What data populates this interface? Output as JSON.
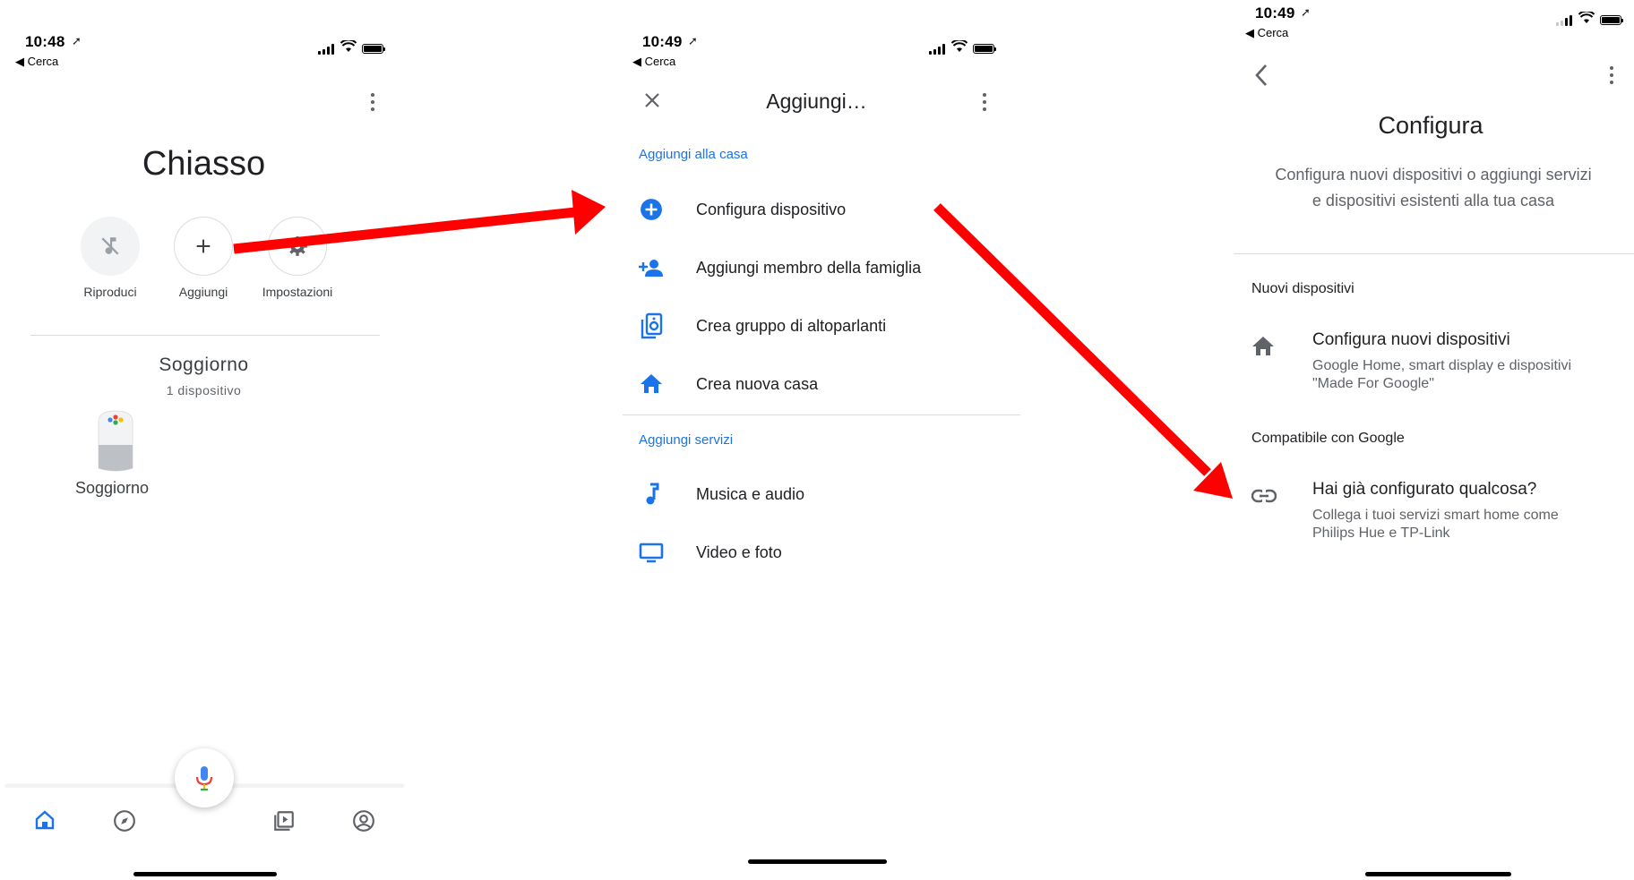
{
  "screen1": {
    "status": {
      "time": "10:48",
      "back": "◀ Cerca"
    },
    "home_name": "Chiasso",
    "actions": [
      {
        "label": "Riproduci",
        "icon": "music-off-icon"
      },
      {
        "label": "Aggiungi",
        "icon": "plus-icon"
      },
      {
        "label": "Impostazioni",
        "icon": "gear-icon"
      }
    ],
    "room": {
      "name": "Soggiorno",
      "count": "1 dispositivo"
    },
    "device": {
      "name": "Soggiorno",
      "icon": "google-home-speaker-icon"
    },
    "nav": [
      "home-icon",
      "explore-icon",
      "media-icon",
      "account-icon"
    ],
    "mic_icon": "mic-icon"
  },
  "screen2": {
    "status": {
      "time": "10:49",
      "back": "◀ Cerca"
    },
    "title": "Aggiungi…",
    "section1": "Aggiungi alla casa",
    "items1": [
      {
        "label": "Configura dispositivo",
        "icon": "add-circle-icon"
      },
      {
        "label": "Aggiungi membro della famiglia",
        "icon": "person-add-icon"
      },
      {
        "label": "Crea gruppo di altoparlanti",
        "icon": "speaker-group-icon"
      },
      {
        "label": "Crea nuova casa",
        "icon": "home-icon"
      }
    ],
    "section2": "Aggiungi servizi",
    "items2": [
      {
        "label": "Musica e audio",
        "icon": "music-note-icon"
      },
      {
        "label": "Video e foto",
        "icon": "tv-icon"
      }
    ]
  },
  "screen3": {
    "status": {
      "time": "10:49",
      "back": "◀ Cerca"
    },
    "title": "Configura",
    "subtitle_line1": "Configura nuovi dispositivi o aggiungi servizi",
    "subtitle_line2": "e dispositivi esistenti alla tua casa",
    "section1": "Nuovi dispositivi",
    "item1": {
      "title": "Configura nuovi dispositivi",
      "desc_line1": "Google Home, smart display e dispositivi",
      "desc_line2": "\"Made For Google\""
    },
    "section2": "Compatibile con Google",
    "item2": {
      "title": "Hai già configurato qualcosa?",
      "desc_line1": "Collega i tuoi servizi smart home come",
      "desc_line2": "Philips Hue e TP-Link"
    }
  },
  "colors": {
    "accent": "#1a73e8",
    "arrow": "#ff0000",
    "text": "#202124",
    "secondary": "#5f6368"
  }
}
